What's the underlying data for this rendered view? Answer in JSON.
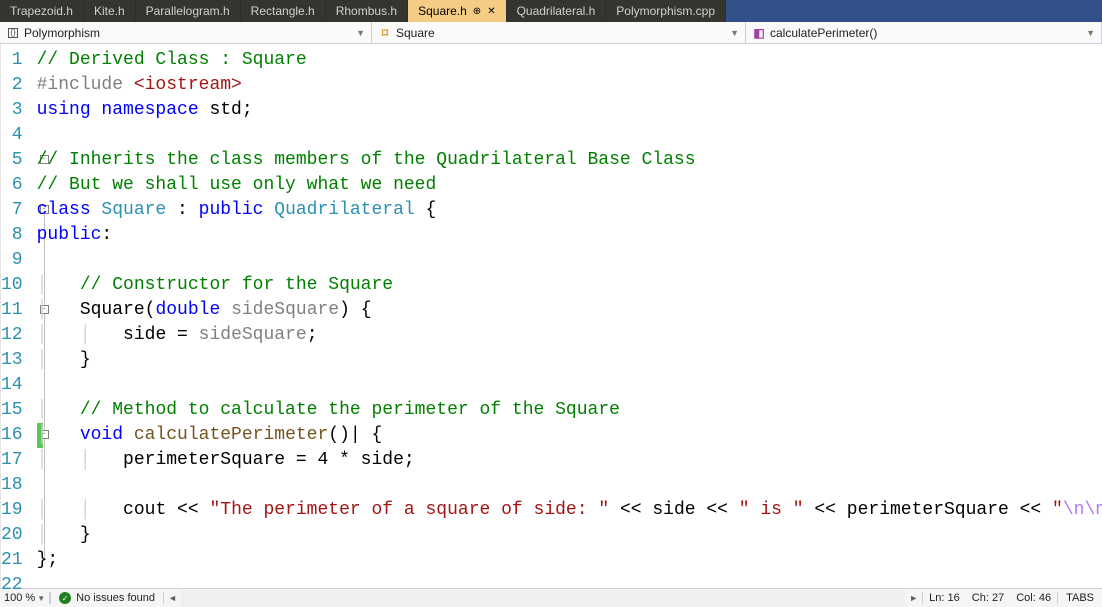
{
  "tabs": [
    {
      "label": "Trapezoid.h",
      "active": false
    },
    {
      "label": "Kite.h",
      "active": false
    },
    {
      "label": "Parallelogram.h",
      "active": false
    },
    {
      "label": "Rectangle.h",
      "active": false
    },
    {
      "label": "Rhombus.h",
      "active": false
    },
    {
      "label": "Square.h",
      "active": true,
      "pinned": true,
      "closable": true
    },
    {
      "label": "Quadrilateral.h",
      "active": false
    },
    {
      "label": "Polymorphism.cpp",
      "active": false
    }
  ],
  "context": {
    "scope": "Polymorphism",
    "type": "Square",
    "member": "calculatePerimeter()"
  },
  "code": {
    "lines": [
      {
        "n": 1,
        "seg": [
          {
            "t": "// Derived Class : Square",
            "c": "c-comment"
          }
        ]
      },
      {
        "n": 2,
        "seg": [
          {
            "t": "#include ",
            "c": "c-pp"
          },
          {
            "t": "<iostream>",
            "c": "c-ppval"
          }
        ]
      },
      {
        "n": 3,
        "seg": [
          {
            "t": "using namespace ",
            "c": "c-kw"
          },
          {
            "t": "std;",
            "c": ""
          }
        ]
      },
      {
        "n": 4,
        "seg": []
      },
      {
        "n": 5,
        "fold": true,
        "seg": [
          {
            "t": "// Inherits the class members of the Quadrilateral Base Class",
            "c": "c-comment"
          }
        ]
      },
      {
        "n": 6,
        "seg": [
          {
            "t": "// But we shall use only what we need",
            "c": "c-comment"
          }
        ]
      },
      {
        "n": 7,
        "fold": true,
        "seg": [
          {
            "t": "class ",
            "c": "c-kw"
          },
          {
            "t": "Square",
            "c": "c-type"
          },
          {
            "t": " : ",
            "c": ""
          },
          {
            "t": "public ",
            "c": "c-kw"
          },
          {
            "t": "Quadrilateral",
            "c": "c-type"
          },
          {
            "t": " {",
            "c": ""
          }
        ]
      },
      {
        "n": 8,
        "seg": [
          {
            "t": "public",
            "c": "c-kw"
          },
          {
            "t": ":",
            "c": ""
          }
        ]
      },
      {
        "n": 9,
        "seg": []
      },
      {
        "n": 10,
        "indent": 1,
        "seg": [
          {
            "t": "// Constructor for the Square",
            "c": "c-comment"
          }
        ]
      },
      {
        "n": 11,
        "fold": true,
        "indent": 1,
        "seg": [
          {
            "t": "Square(",
            "c": ""
          },
          {
            "t": "double ",
            "c": "c-kw"
          },
          {
            "t": "sideSquare",
            "c": "c-param"
          },
          {
            "t": ") {",
            "c": ""
          }
        ]
      },
      {
        "n": 12,
        "indent": 2,
        "seg": [
          {
            "t": "side = ",
            "c": ""
          },
          {
            "t": "sideSquare",
            "c": "c-param"
          },
          {
            "t": ";",
            "c": ""
          }
        ]
      },
      {
        "n": 13,
        "indent": 1,
        "seg": [
          {
            "t": "}",
            "c": ""
          }
        ]
      },
      {
        "n": 14,
        "seg": []
      },
      {
        "n": 15,
        "indent": 1,
        "seg": [
          {
            "t": "// Method to calculate the perimeter of the Square",
            "c": "c-comment"
          }
        ]
      },
      {
        "n": 16,
        "fold": true,
        "indent": 1,
        "caret": true,
        "changed": true,
        "seg": [
          {
            "t": "void ",
            "c": "c-kw"
          },
          {
            "t": "calculatePerimeter",
            "c": "c-func"
          },
          {
            "t": "()",
            "c": ""
          },
          {
            "t": "|",
            "c": "",
            "caret": true
          },
          {
            "t": " {",
            "c": ""
          }
        ]
      },
      {
        "n": 17,
        "indent": 2,
        "seg": [
          {
            "t": "perimeterSquare = 4 * side;",
            "c": ""
          }
        ]
      },
      {
        "n": 18,
        "seg": []
      },
      {
        "n": 19,
        "indent": 2,
        "seg": [
          {
            "t": "cout << ",
            "c": ""
          },
          {
            "t": "\"The perimeter of a square of side: \"",
            "c": "c-str"
          },
          {
            "t": " << side << ",
            "c": ""
          },
          {
            "t": "\" is \"",
            "c": "c-str"
          },
          {
            "t": " << perimeterSquare << ",
            "c": ""
          },
          {
            "t": "\"",
            "c": "c-str"
          },
          {
            "t": "\\n\\n",
            "c": "c-esc"
          },
          {
            "t": "\"",
            "c": "c-str"
          },
          {
            "t": ";",
            "c": ""
          }
        ]
      },
      {
        "n": 20,
        "indent": 1,
        "seg": [
          {
            "t": "}",
            "c": ""
          }
        ]
      },
      {
        "n": 21,
        "seg": [
          {
            "t": "};",
            "c": ""
          }
        ]
      },
      {
        "n": 22,
        "seg": []
      }
    ]
  },
  "status": {
    "zoom": "100 %",
    "issues": "No issues found",
    "ln_label": "Ln:",
    "ln": "16",
    "ch_label": "Ch:",
    "ch": "27",
    "col_label": "Col:",
    "col": "46",
    "tabs_mode": "TABS"
  }
}
